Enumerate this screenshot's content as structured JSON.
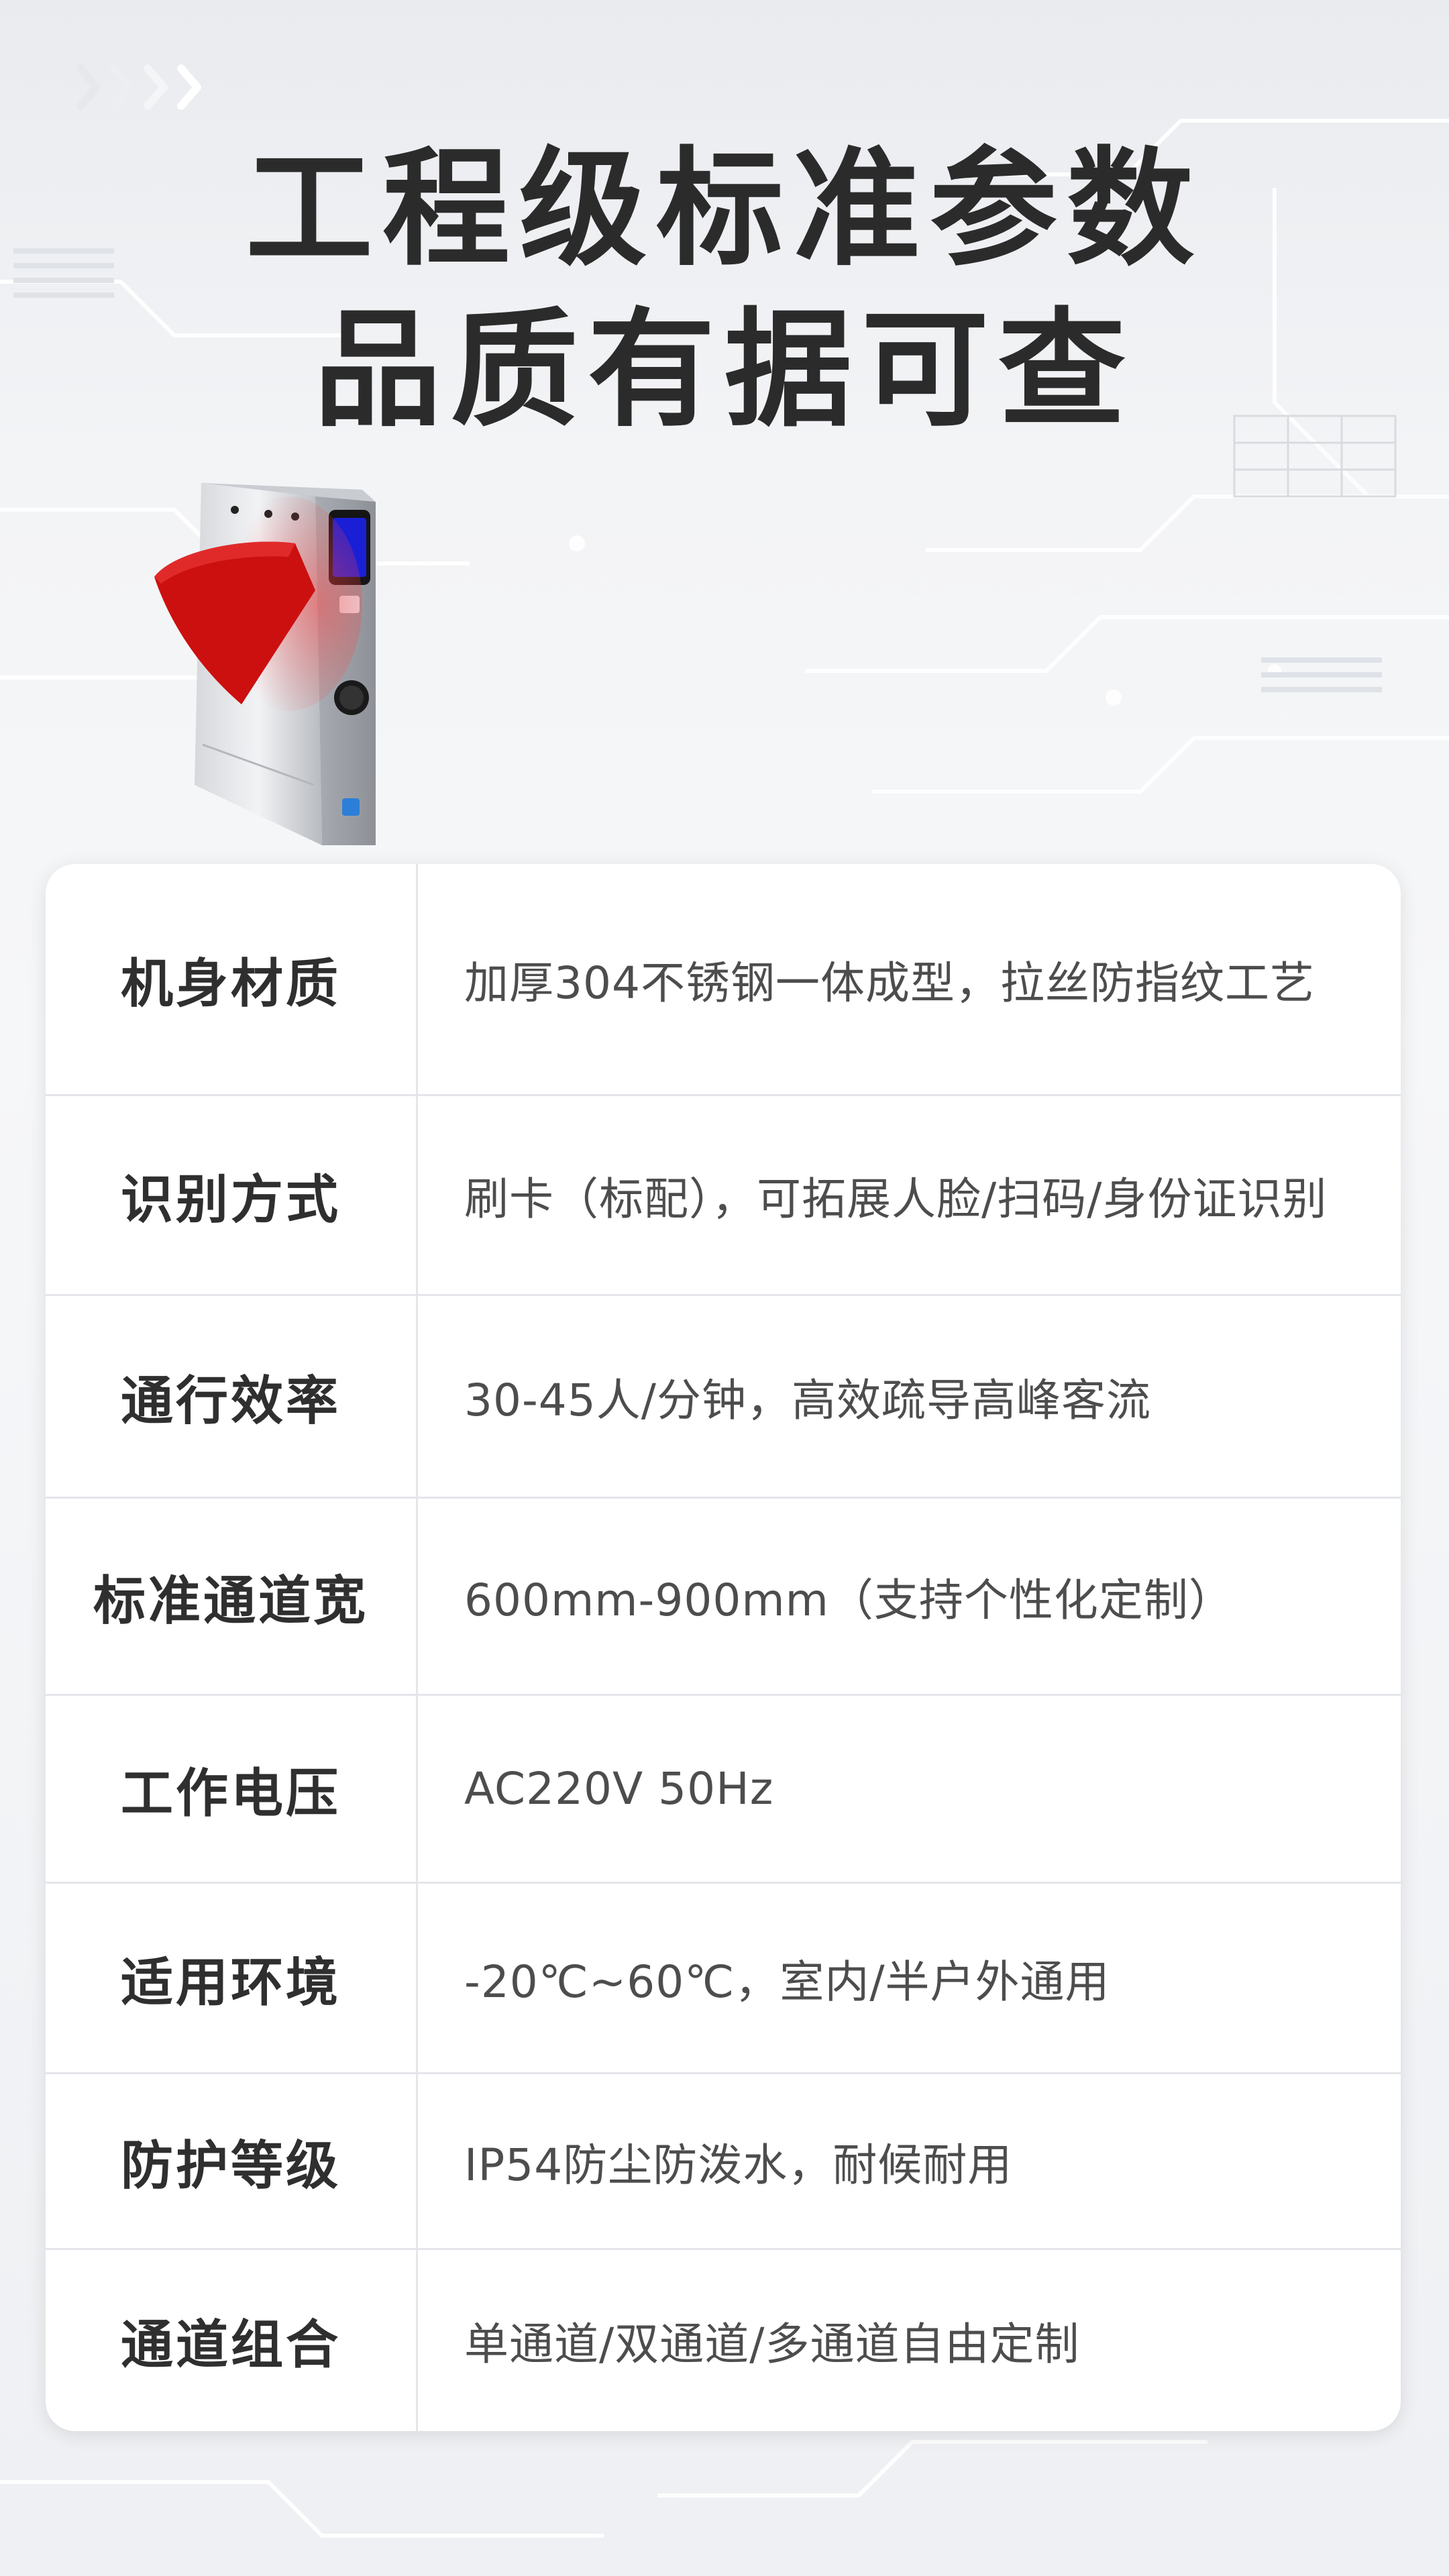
{
  "header": {
    "title_line1": "工程级标准参数",
    "title_line2": "品质有据可查"
  },
  "specs": [
    {
      "label": "机身材质",
      "value": "加厚304不锈钢一体成型，拉丝防指纹工艺"
    },
    {
      "label": "识别方式",
      "value": "刷卡（标配），可拓展人脸/扫码/身份证识别"
    },
    {
      "label": "通行效率",
      "value": "30-45人/分钟，高效疏导高峰客流"
    },
    {
      "label": "标准通道宽",
      "value": "600mm-900mm（支持个性化定制）"
    },
    {
      "label": "工作电压",
      "value": "AC220V 50Hz"
    },
    {
      "label": "适用环境",
      "value": "-20℃~60℃，室内/半户外通用"
    },
    {
      "label": "防护等级",
      "value": "IP54防尘防泼水，耐候耐用"
    },
    {
      "label": "通道组合",
      "value": "单通道/双通道/多通道自由定制"
    }
  ],
  "colors": {
    "flap_red": "#cc1010",
    "screen_blue": "#1a1fd6",
    "title_text": "#2b2b2b"
  }
}
